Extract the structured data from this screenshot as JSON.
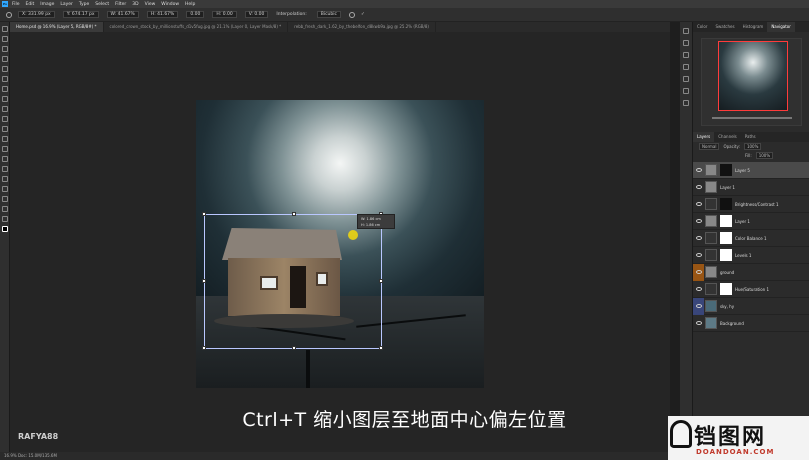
{
  "app": {
    "menus": [
      "File",
      "Edit",
      "Image",
      "Layer",
      "Type",
      "Select",
      "Filter",
      "3D",
      "View",
      "Window",
      "Help"
    ]
  },
  "options": {
    "x": "X: 331.99 px",
    "y": "Y: 674.17 px",
    "w": "W: 41.67%",
    "h": "H: 41.67%",
    "angle": "0.00",
    "hskew": "H: 0.00",
    "vskew": "V: 0.00",
    "interpolation_label": "Interpolation:",
    "interpolation_value": "Bicubic"
  },
  "tabs": [
    {
      "label": "Home.psd @ 16.9% (Layer 5, RGB/8#) *",
      "active": true
    },
    {
      "label": "colored_crown_stock_by_millionstuffs_d1v5fug.jpg @ 21.1% (Layer 0, Layer Mask/8) *",
      "active": false
    },
    {
      "label": "rebb_fresh_dark_1.62_by_thebelfon_d8kwb9a.jpg @ 25.2% (RGB/8)",
      "active": false
    }
  ],
  "transform_tooltip": {
    "w": "W: 1.86 cm",
    "h": "H: 1.86 cm"
  },
  "caption": "Ctrl+T 缩小图层至地面中心偏左位置",
  "creator": "RAFYA88",
  "status": "16.9%    Doc: 15.0M/135.6M",
  "panels": {
    "top_tabs": [
      "Color",
      "Swatches",
      "Histogram",
      "Navigator"
    ],
    "layer_tabs": [
      "Layers",
      "Channels",
      "Paths"
    ],
    "blend_mode": "Normal",
    "opacity_label": "Opacity:",
    "opacity": "100%",
    "fill_label": "Fill:",
    "fill": "100%"
  },
  "layers": [
    {
      "name": "Layer 5",
      "selected": true,
      "mask": true
    },
    {
      "name": "Layer 1",
      "selected": false,
      "mask": false
    },
    {
      "name": "Brightness/Contrast 1",
      "selected": false,
      "mask": true
    },
    {
      "name": "Layer 1",
      "selected": false,
      "mask": true
    },
    {
      "name": "Color Balance 1",
      "selected": false,
      "mask": true
    },
    {
      "name": "Levels 1",
      "selected": false,
      "mask": true
    },
    {
      "name": "ground",
      "selected": false,
      "mask": false,
      "color": "orange"
    },
    {
      "name": "Hue/Saturation 1",
      "selected": false,
      "mask": true
    },
    {
      "name": "sky, hy",
      "selected": false,
      "mask": false,
      "color": "blue"
    },
    {
      "name": "Background",
      "selected": false,
      "mask": false
    }
  ],
  "watermark": {
    "title": "铛图网",
    "sub": "DOANDOAN.COM"
  }
}
